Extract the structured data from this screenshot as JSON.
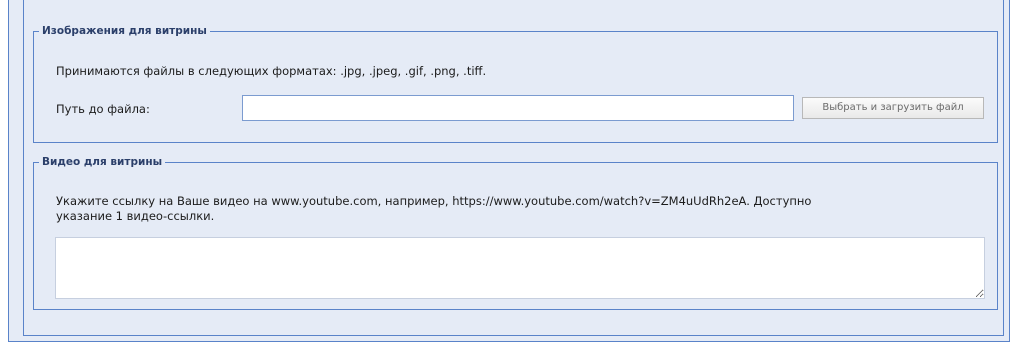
{
  "images_section": {
    "legend": "Изображения для витрины",
    "formats_note": "Принимаются файлы в следующих форматах: .jpg, .jpeg, .gif, .png, .tiff.",
    "path_label": "Путь до файла:",
    "path_value": "",
    "upload_button": "Выбрать и загрузить файл"
  },
  "video_section": {
    "legend": "Видео для витрины",
    "hint_line1": "Укажите ссылку на Ваше видео на www.youtube.com, например, https://www.youtube.com/watch?v=ZM4uUdRh2eA. Доступно",
    "hint_line2": "указание 1 видео-ссылки.",
    "video_value": ""
  },
  "colors": {
    "panel_bg": "#e5ebf6",
    "border": "#5a83c9",
    "legend_text": "#2b3f6a"
  }
}
